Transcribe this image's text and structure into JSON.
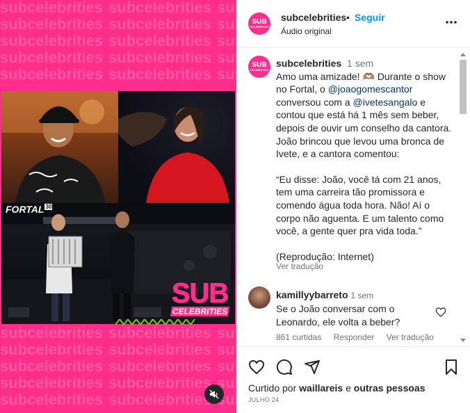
{
  "watermark": {
    "text": "subcelebrities"
  },
  "media": {
    "fortal_label": "FORTAL",
    "fortal_badge": "30",
    "logo_big": "SUB",
    "logo_small": "CELEBRITIES"
  },
  "header": {
    "username": "subcelebrities",
    "separator": "•",
    "follow_label": "Seguir",
    "audio_label": "Áudio original",
    "avatar_big": "SUB",
    "avatar_small": "CELEBRITIES"
  },
  "caption": {
    "username": "subcelebrities",
    "time": "1 sem",
    "line_1": "Amo uma amizade! 🫶🏽 Durante o show no Fortal, o ",
    "mention_1": "@joaogomescantor",
    "line_2": " conversou com a ",
    "mention_2": "@ivetesangalo",
    "line_3": " e contou que está há 1 mês sem beber, depois de ouvir um conselho da cantora. João brincou que levou uma bronca de Ivete, e a cantora comentou:",
    "quote": "“Eu disse: João, você tá com 21 anos, tem uma carreira tão promissora e comendo água toda hora. Não! Aí o corpo não aguenta. E um talento como você, a gente quer pra vida toda.”",
    "credit": "(Reprodução: Internet)",
    "translate_label": "Ver tradução"
  },
  "comment": {
    "username": "kamillyybarreto",
    "time": "1 sem",
    "text": "Se o João conversar com o Leonardo, ele volta a beber?",
    "likes_label": "861 curtidas",
    "reply_label": "Responder",
    "translate_label": "Ver tradução"
  },
  "footer": {
    "liked_prefix": "Curtido por ",
    "liked_user": "waillareis",
    "liked_mid": " e ",
    "liked_others": "outras pessoas",
    "date": "JULHO 24"
  },
  "colors": {
    "brand_pink": "#ff2d8b",
    "link_blue": "#0095f6"
  }
}
